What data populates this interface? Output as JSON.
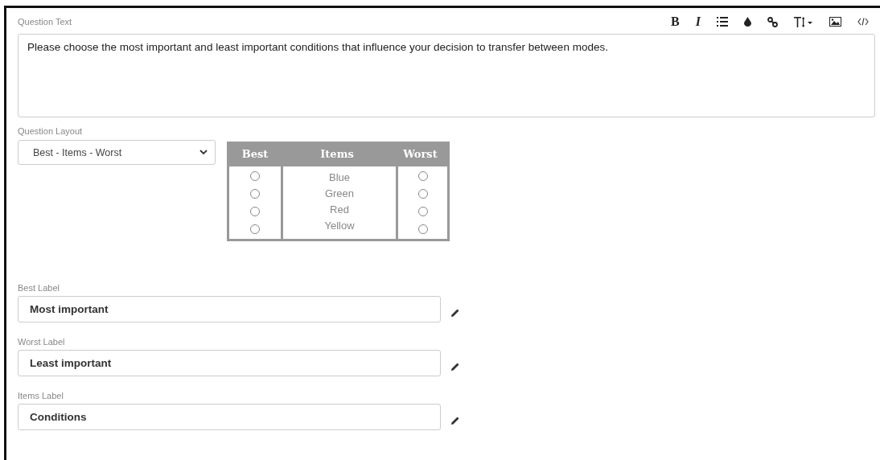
{
  "question_text": {
    "label": "Question Text",
    "value": "Please choose the most important and least important conditions that influence your decision to transfer between modes."
  },
  "toolbar": [
    {
      "kind": "bold",
      "label": "B"
    },
    {
      "kind": "italic",
      "label": "I"
    },
    {
      "kind": "list"
    },
    {
      "kind": "color"
    },
    {
      "kind": "link"
    },
    {
      "kind": "text-size"
    },
    {
      "kind": "image"
    },
    {
      "kind": "code"
    }
  ],
  "layout": {
    "label": "Question Layout",
    "value": "Best - Items - Worst"
  },
  "preview": {
    "columns": [
      "Best",
      "Items",
      "Worst"
    ],
    "rows": [
      {
        "label": "Blue",
        "best_selected": false,
        "worst_selected": false
      },
      {
        "label": "Green",
        "best_selected": false,
        "worst_selected": false
      },
      {
        "label": "Red",
        "best_selected": false,
        "worst_selected": false
      },
      {
        "label": "Yellow",
        "best_selected": false,
        "worst_selected": false
      }
    ]
  },
  "fields": [
    {
      "label": "Best Label",
      "value": "Most important"
    },
    {
      "label": "Worst Label",
      "value": "Least important"
    },
    {
      "label": "Items Label",
      "value": "Conditions"
    }
  ]
}
